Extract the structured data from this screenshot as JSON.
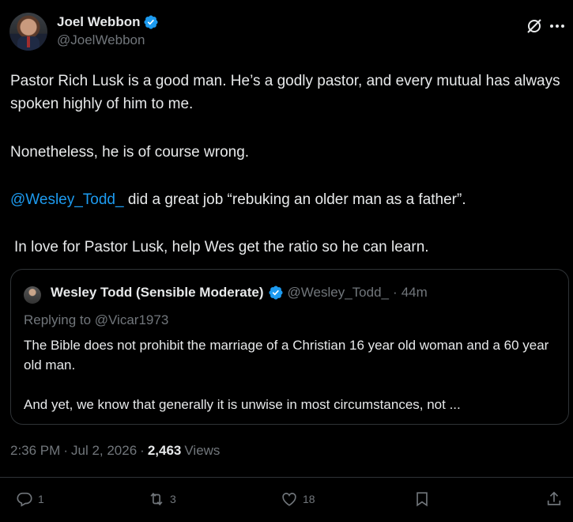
{
  "author": {
    "display_name": "Joel Webbon",
    "handle": "@JoelWebbon"
  },
  "post": {
    "p1": "Pastor Rich Lusk is a good man. He’s a godly pastor, and every mutual has always spoken highly of him to me.",
    "p2": "Nonetheless, he is of course wrong.",
    "p3_mention": "@Wesley_Todd_",
    "p3_rest": " did a great job “rebuking an older man as a father”.",
    "p4": "In love for Pastor Lusk, help Wes get the ratio so he can learn."
  },
  "quote": {
    "display_name": "Wesley Todd (Sensible Moderate)",
    "handle": "@Wesley_Todd_",
    "separator": "·",
    "time": "44m",
    "replying_to": "Replying to @Vicar1973",
    "line1": "The Bible does not prohibit the marriage of a Christian 16 year old woman and a 60 year old man.",
    "line2": "And yet, we know that generally it is unwise in most circumstances, not ..."
  },
  "meta": {
    "time": "2:36 PM",
    "sep1": "·",
    "date": "Jul 2, 2026",
    "sep2": "·",
    "views_count": "2,463",
    "views_label": "Views"
  },
  "actions": {
    "replies": "1",
    "reposts": "3",
    "likes": "18"
  },
  "colors": {
    "background": "#000000",
    "text": "#e7e9ea",
    "muted": "#71767b",
    "accent": "#1d9bf0",
    "border": "#2f3336"
  },
  "icons": [
    "verified-badge-icon",
    "grok-icon",
    "more-icon",
    "reply-icon",
    "repost-icon",
    "like-icon",
    "bookmark-icon",
    "share-icon"
  ]
}
